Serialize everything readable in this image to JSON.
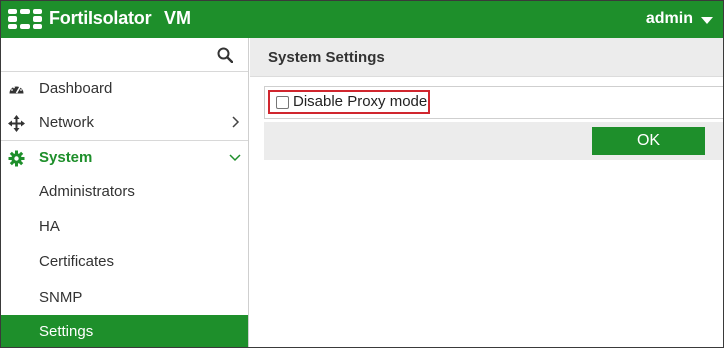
{
  "header": {
    "brand": "FortiIsolator",
    "edition": "VM",
    "user": "admin"
  },
  "sidebar": {
    "search_icon": "search-icon",
    "items": [
      {
        "label": "Dashboard",
        "icon": "dashboard-icon"
      },
      {
        "label": "Network",
        "icon": "network-icon"
      },
      {
        "label": "System",
        "icon": "gear-icon",
        "expanded": true
      },
      {
        "label": "Administrators"
      },
      {
        "label": "HA"
      },
      {
        "label": "Certificates"
      },
      {
        "label": "SNMP"
      },
      {
        "label": "Settings",
        "active": true
      }
    ]
  },
  "main": {
    "title": "System Settings",
    "checkbox_label": "Disable Proxy mode",
    "checkbox_checked": false,
    "ok_label": "OK"
  },
  "colors": {
    "brand_green": "#1e8f2b",
    "highlight_red": "#d0262e"
  }
}
